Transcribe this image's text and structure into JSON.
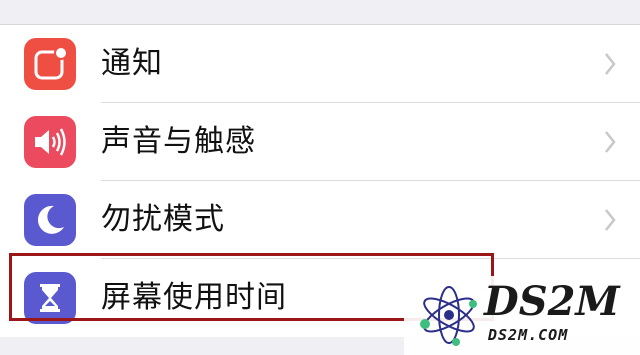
{
  "settings": {
    "items": [
      {
        "label": "通知",
        "icon": "notification-icon",
        "color": "#ef4e43"
      },
      {
        "label": "声音与触感",
        "icon": "speaker-icon",
        "color": "#ec4a5e"
      },
      {
        "label": "勿扰模式",
        "icon": "moon-icon",
        "color": "#5b59d0"
      },
      {
        "label": "屏幕使用时间",
        "icon": "hourglass-icon",
        "color": "#5b59d0"
      }
    ],
    "highlight_color": "#9b1717"
  },
  "watermark": {
    "title": "DS2M",
    "url": "DS2M.COM"
  }
}
